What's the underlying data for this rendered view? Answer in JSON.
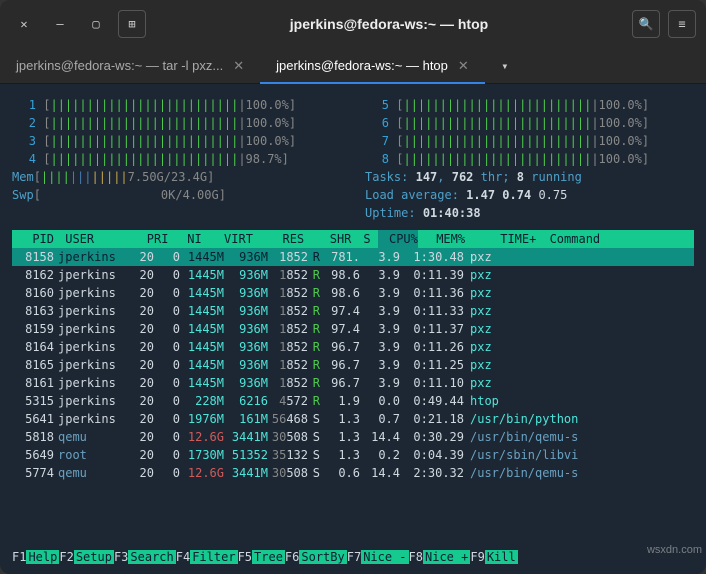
{
  "titlebar": {
    "title": "jperkins@fedora-ws:~ — htop",
    "close_glyph": "✕",
    "min_glyph": "—",
    "max_glyph": "▢",
    "new_glyph": "⊞",
    "search_glyph": "🔍",
    "menu_glyph": "≡"
  },
  "tabs": {
    "items": [
      {
        "label": "jperkins@fedora-ws:~ — tar -l pxz...",
        "active": false
      },
      {
        "label": "jperkins@fedora-ws:~ — htop",
        "active": true
      }
    ],
    "expand_glyph": "▾",
    "close_glyph": "✕"
  },
  "cpus": [
    {
      "n": "1",
      "pct": "100.0%"
    },
    {
      "n": "2",
      "pct": "100.0%"
    },
    {
      "n": "3",
      "pct": "100.0%"
    },
    {
      "n": "4",
      "pct": "98.7%"
    },
    {
      "n": "5",
      "pct": "100.0%"
    },
    {
      "n": "6",
      "pct": "100.0%"
    },
    {
      "n": "7",
      "pct": "100.0%"
    },
    {
      "n": "8",
      "pct": "100.0%"
    }
  ],
  "mem": {
    "label": "Mem",
    "val": "7.50G/23.4G"
  },
  "swp": {
    "label": "Swp",
    "val": "0K/4.00G"
  },
  "tasks": {
    "label": "Tasks:",
    "procs": "147",
    "sep": ",",
    "thr": "762",
    "thr_lbl": "thr;",
    "run": "8",
    "run_lbl": "running"
  },
  "load": {
    "label": "Load average:",
    "a": "1.47",
    "b": "0.74",
    "c": "0.75"
  },
  "uptime": {
    "label": "Uptime:",
    "val": "01:40:38"
  },
  "cols": {
    "pid": "PID",
    "user": "USER",
    "pri": "PRI",
    "ni": "NI",
    "virt": "VIRT",
    "res": "RES",
    "shr": "SHR",
    "s": "S",
    "cpu": "CPU%",
    "mem": "MEM%",
    "time": "TIME+",
    "cmd": "Command"
  },
  "procs": [
    {
      "pid": "8158",
      "user": "jperkins",
      "pri": "20",
      "ni": "0",
      "virt": "1445M",
      "res": "936M",
      "shr_d": "1",
      "shr": "852",
      "s": "R",
      "cpu": "781.",
      "mem": "3.9",
      "time": "1:30.48",
      "cmd": "pxz",
      "sel": true
    },
    {
      "pid": "8162",
      "user": "jperkins",
      "pri": "20",
      "ni": "0",
      "virt": "1445M",
      "res": "936M",
      "shr_d": "1",
      "shr": "852",
      "s": "R",
      "cpu": "98.6",
      "mem": "3.9",
      "time": "0:11.39",
      "cmd": "pxz"
    },
    {
      "pid": "8160",
      "user": "jperkins",
      "pri": "20",
      "ni": "0",
      "virt": "1445M",
      "res": "936M",
      "shr_d": "1",
      "shr": "852",
      "s": "R",
      "cpu": "98.6",
      "mem": "3.9",
      "time": "0:11.36",
      "cmd": "pxz"
    },
    {
      "pid": "8163",
      "user": "jperkins",
      "pri": "20",
      "ni": "0",
      "virt": "1445M",
      "res": "936M",
      "shr_d": "1",
      "shr": "852",
      "s": "R",
      "cpu": "97.4",
      "mem": "3.9",
      "time": "0:11.33",
      "cmd": "pxz"
    },
    {
      "pid": "8159",
      "user": "jperkins",
      "pri": "20",
      "ni": "0",
      "virt": "1445M",
      "res": "936M",
      "shr_d": "1",
      "shr": "852",
      "s": "R",
      "cpu": "97.4",
      "mem": "3.9",
      "time": "0:11.37",
      "cmd": "pxz"
    },
    {
      "pid": "8164",
      "user": "jperkins",
      "pri": "20",
      "ni": "0",
      "virt": "1445M",
      "res": "936M",
      "shr_d": "1",
      "shr": "852",
      "s": "R",
      "cpu": "96.7",
      "mem": "3.9",
      "time": "0:11.26",
      "cmd": "pxz"
    },
    {
      "pid": "8165",
      "user": "jperkins",
      "pri": "20",
      "ni": "0",
      "virt": "1445M",
      "res": "936M",
      "shr_d": "1",
      "shr": "852",
      "s": "R",
      "cpu": "96.7",
      "mem": "3.9",
      "time": "0:11.25",
      "cmd": "pxz"
    },
    {
      "pid": "8161",
      "user": "jperkins",
      "pri": "20",
      "ni": "0",
      "virt": "1445M",
      "res": "936M",
      "shr_d": "1",
      "shr": "852",
      "s": "R",
      "cpu": "96.7",
      "mem": "3.9",
      "time": "0:11.10",
      "cmd": "pxz"
    },
    {
      "pid": "5315",
      "user": "jperkins",
      "pri": "20",
      "ni": "0",
      "virt": "228M",
      "res": "6216",
      "shr_d": "4",
      "shr": "572",
      "s": "R",
      "cpu": "1.9",
      "mem": "0.0",
      "time": "0:49.44",
      "cmd": "htop"
    },
    {
      "pid": "5641",
      "user": "jperkins",
      "pri": "20",
      "ni": "0",
      "virt": "1976M",
      "res": "161M",
      "shr_d": "56",
      "shr": "468",
      "s": "S",
      "cpu": "1.3",
      "mem": "0.7",
      "time": "0:21.18",
      "cmd": "/usr/bin/python"
    },
    {
      "pid": "5818",
      "user": "qemu",
      "pri": "20",
      "ni": "0",
      "virt": "12.6G",
      "virt_red": true,
      "res": "3441M",
      "shr_d": "30",
      "shr": "508",
      "s": "S",
      "cpu": "1.3",
      "mem": "14.4",
      "time": "0:30.29",
      "cmd": "/usr/bin/qemu-s",
      "dim": true
    },
    {
      "pid": "5649",
      "user": "root",
      "pri": "20",
      "ni": "0",
      "virt": "1730M",
      "res": "51352",
      "shr_d": "35",
      "shr": "132",
      "s": "S",
      "cpu": "1.3",
      "mem": "0.2",
      "time": "0:04.39",
      "cmd": "/usr/sbin/libvi",
      "dim": true
    },
    {
      "pid": "5774",
      "user": "qemu",
      "pri": "20",
      "ni": "0",
      "virt": "12.6G",
      "virt_red": true,
      "res": "3441M",
      "shr_d": "30",
      "shr": "508",
      "s": "S",
      "cpu": "0.6",
      "mem": "14.4",
      "time": "2:30.32",
      "cmd": "/usr/bin/qemu-s",
      "dim": true
    }
  ],
  "fkeys": [
    {
      "k": "F1",
      "l": "Help"
    },
    {
      "k": "F2",
      "l": "Setup"
    },
    {
      "k": "F3",
      "l": "Search"
    },
    {
      "k": "F4",
      "l": "Filter"
    },
    {
      "k": "F5",
      "l": "Tree"
    },
    {
      "k": "F6",
      "l": "SortBy"
    },
    {
      "k": "F7",
      "l": "Nice -"
    },
    {
      "k": "F8",
      "l": "Nice +"
    },
    {
      "k": "F9",
      "l": "Kill"
    }
  ],
  "watermark": "wsxdn.com"
}
